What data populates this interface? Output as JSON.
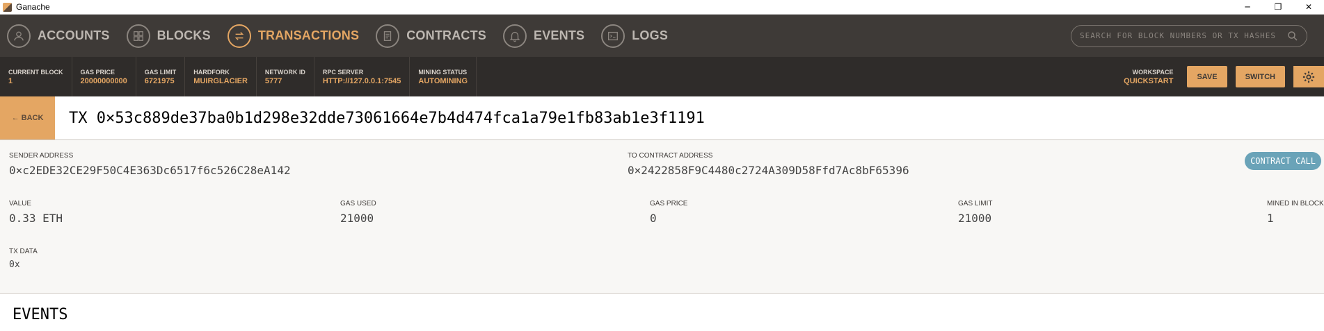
{
  "window": {
    "title": "Ganache",
    "minimize": "─",
    "restore": "❐",
    "close": "✕"
  },
  "nav": {
    "items": [
      {
        "label": "ACCOUNTS",
        "icon": "account-icon"
      },
      {
        "label": "BLOCKS",
        "icon": "blocks-icon"
      },
      {
        "label": "TRANSACTIONS",
        "icon": "transactions-icon",
        "active": true
      },
      {
        "label": "CONTRACTS",
        "icon": "contracts-icon"
      },
      {
        "label": "EVENTS",
        "icon": "bell-icon"
      },
      {
        "label": "LOGS",
        "icon": "logs-icon"
      }
    ],
    "search_placeholder": "SEARCH FOR BLOCK NUMBERS OR TX HASHES"
  },
  "stats": [
    {
      "label": "CURRENT BLOCK",
      "value": "1"
    },
    {
      "label": "GAS PRICE",
      "value": "20000000000"
    },
    {
      "label": "GAS LIMIT",
      "value": "6721975"
    },
    {
      "label": "HARDFORK",
      "value": "MUIRGLACIER"
    },
    {
      "label": "NETWORK ID",
      "value": "5777"
    },
    {
      "label": "RPC SERVER",
      "value": "HTTP://127.0.0.1:7545"
    },
    {
      "label": "MINING STATUS",
      "value": "AUTOMINING"
    }
  ],
  "workspace": {
    "label": "WORKSPACE",
    "value": "QUICKSTART"
  },
  "buttons": {
    "save": "SAVE",
    "switch": "SWITCH"
  },
  "tx": {
    "back_label": "← BACK",
    "title": "TX 0×53c889de37ba0b1d298e32dde73061664e7b4d474fca1a79e1fb83ab1e3f1191",
    "sender_label": "SENDER ADDRESS",
    "sender": "0×c2EDE32CE29F50C4E363Dc6517f6c526C28eA142",
    "to_label": "TO CONTRACT ADDRESS",
    "to": "0×2422858F9C4480c2724A309D58Ffd7Ac8bF65396",
    "badge": "CONTRACT CALL",
    "value_label": "VALUE",
    "value": "0.33 ETH",
    "gas_used_label": "GAS USED",
    "gas_used": "21000",
    "gas_price_label": "GAS PRICE",
    "gas_price": "0",
    "gas_limit_label": "GAS LIMIT",
    "gas_limit": "21000",
    "mined_label": "MINED IN BLOCK",
    "mined": "1",
    "data_label": "TX DATA",
    "data": "0x"
  },
  "events": {
    "title": "EVENTS"
  },
  "colors": {
    "accent": "#e4a663",
    "nav_bg": "#3e3a37",
    "stats_bg": "#2f2c2a",
    "badge": "#6aa3b8"
  }
}
